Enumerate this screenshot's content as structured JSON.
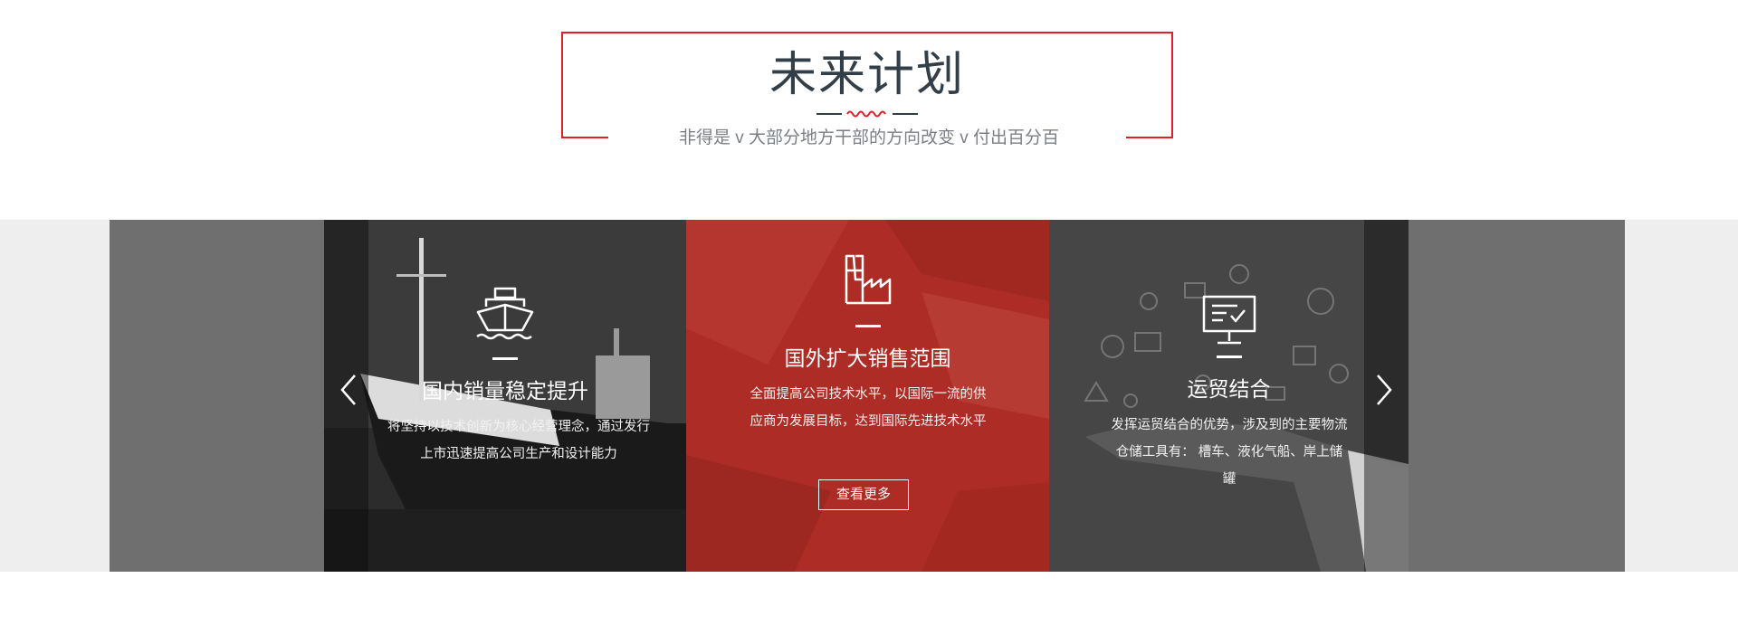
{
  "section": {
    "title": "未来计划",
    "subtitle": "非得是 v 大部分地方干部的方向改变 v 付出百分百",
    "accent_color": "#e31e24"
  },
  "carousel": {
    "prev_icon": "chevron-left-icon",
    "next_icon": "chevron-right-icon",
    "cards": [
      {
        "icon": "ship-icon",
        "title": "国内销量稳定提升",
        "description": "将坚持以技术创新为核心经营理念，通过发行上市迅速提高公司生产和设计能力"
      },
      {
        "icon": "factory-icon",
        "title": "国外扩大销售范围",
        "description": "全面提高公司技术水平，以国际一流的供应商为发展目标，达到国际先进技术水平",
        "button_label": "查看更多",
        "highlight_color": "#ad2d26"
      },
      {
        "icon": "monitor-check-icon",
        "title": "运贸结合",
        "description": "发挥运贸结合的优势，涉及到的主要物流仓储工具有： 槽车、液化气船、岸上储罐"
      }
    ]
  }
}
